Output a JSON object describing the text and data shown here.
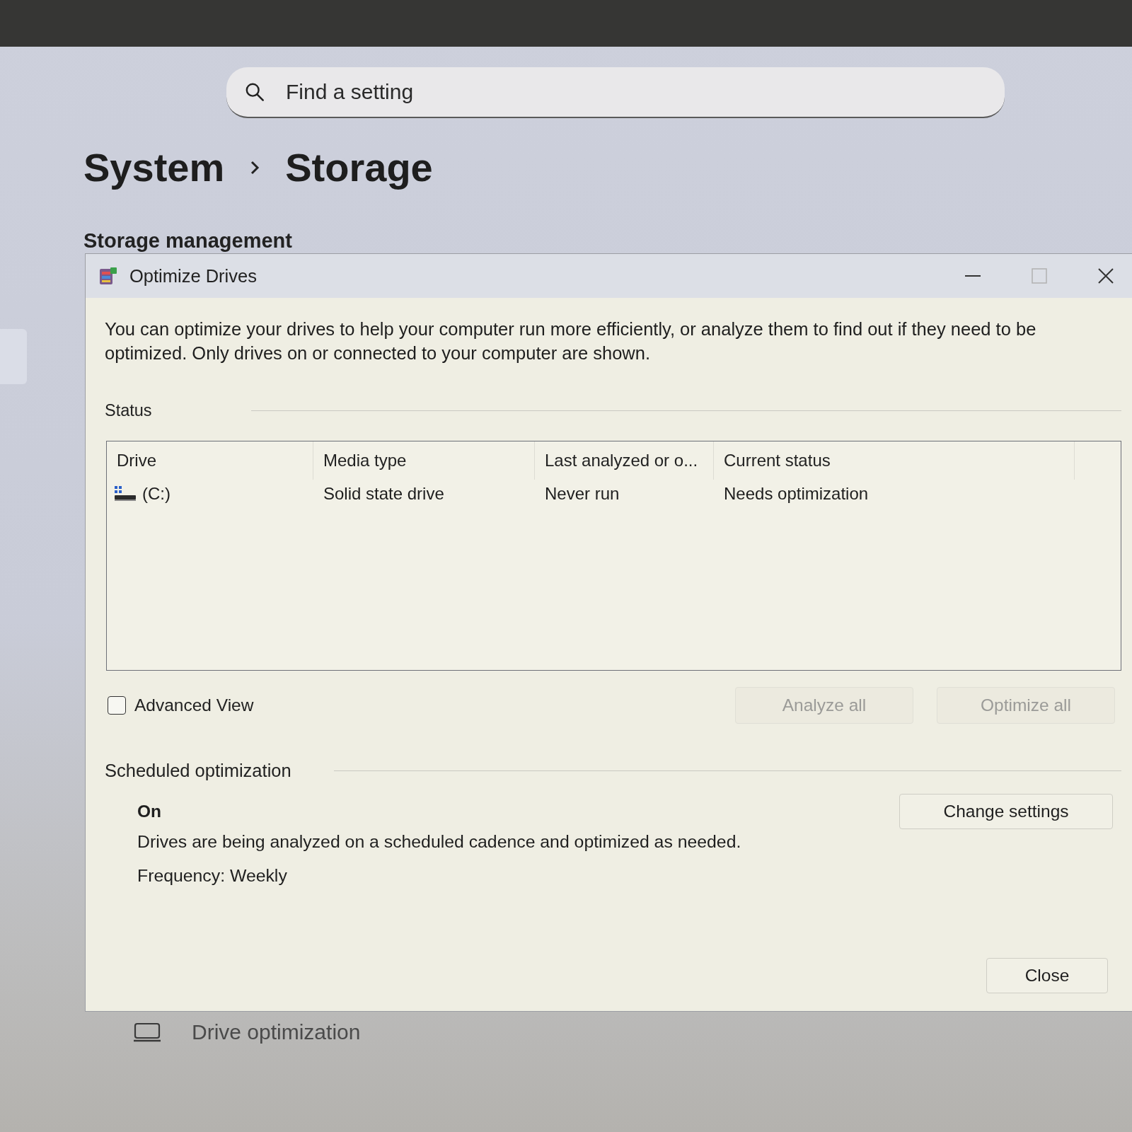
{
  "search": {
    "placeholder": "Find a setting"
  },
  "breadcrumb": [
    {
      "label": "System"
    },
    {
      "label": "Storage"
    }
  ],
  "section_heading": "Storage management",
  "dialog": {
    "title": "Optimize Drives",
    "window_controls": [
      {
        "kind": "minimize",
        "disabled": false
      },
      {
        "kind": "maximize",
        "disabled": true
      },
      {
        "kind": "close",
        "disabled": false
      }
    ],
    "description": "You can optimize your drives to help your computer run more efficiently, or analyze them to find out if they need to be optimized. Only drives on or connected to your computer are shown.",
    "status": {
      "label": "Status",
      "table": {
        "columns": [
          "Drive",
          "Media type",
          "Last analyzed or o...",
          "Current status"
        ],
        "rows": [
          {
            "cells": [
              "(C:)",
              "Solid state drive",
              "Never run",
              "Needs optimization"
            ]
          }
        ]
      }
    },
    "advanced_view": {
      "label": "Advanced View",
      "checked": false
    },
    "actions": [
      {
        "label": "Analyze all",
        "disabled": true
      },
      {
        "label": "Optimize all",
        "disabled": true
      }
    ],
    "scheduled_optimization": {
      "heading": "Scheduled optimization",
      "state": "On",
      "description": "Drives are being analyzed on a scheduled cadence and optimized as needed.",
      "frequency": "Frequency: Weekly",
      "button": {
        "label": "Change settings",
        "disabled": false
      }
    },
    "close_button": {
      "label": "Close",
      "disabled": false
    }
  },
  "settings_item": {
    "label": "Drive optimization"
  }
}
